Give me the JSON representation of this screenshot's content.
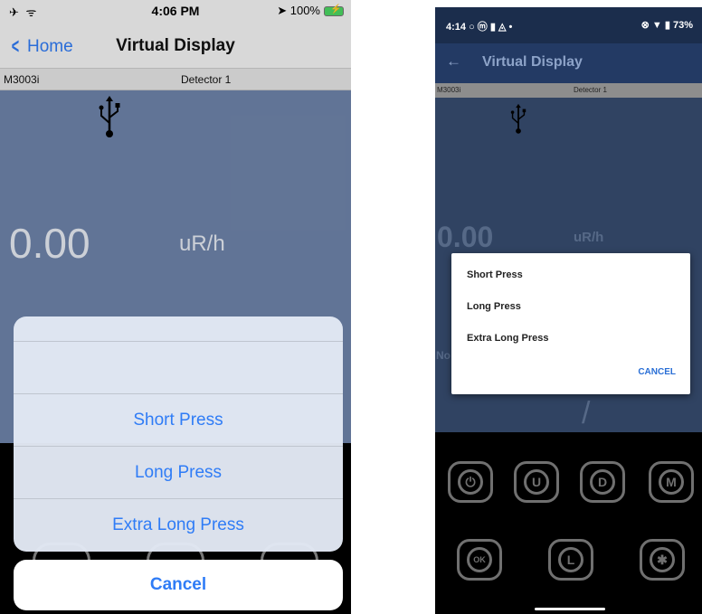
{
  "ios": {
    "status": {
      "left_icons": "✈ ᯤ",
      "time": "4:06 PM",
      "right": "➤ 100%"
    },
    "nav": {
      "back_label": "Home",
      "title": "Virtual Display"
    },
    "subbar": {
      "model": "M3003i",
      "detector": "Detector 1"
    },
    "display": {
      "value": "0.00",
      "unit": "uR/h"
    },
    "sheet": {
      "options": [
        "Short Press",
        "Long Press",
        "Extra Long Press"
      ],
      "cancel": "Cancel"
    }
  },
  "android": {
    "status": {
      "left": "4:14 ○ ⓜ ▮ ◬ •",
      "right": "⊗ ▼ ▮ 73%"
    },
    "appbar": {
      "back": "←",
      "title": "Virtual Display"
    },
    "subbar": {
      "model": "M3003i",
      "detector": "Detector 1"
    },
    "display": {
      "value": "0.00",
      "unit": "uR/h",
      "side_text": "No"
    },
    "dialog": {
      "options": [
        "Short Press",
        "Long Press",
        "Extra Long Press"
      ],
      "cancel": "CANCEL"
    },
    "keys": {
      "power": "⏻",
      "up": "U",
      "down": "D",
      "mode": "M",
      "ok": "OK",
      "light": "L",
      "star": "✱"
    }
  }
}
